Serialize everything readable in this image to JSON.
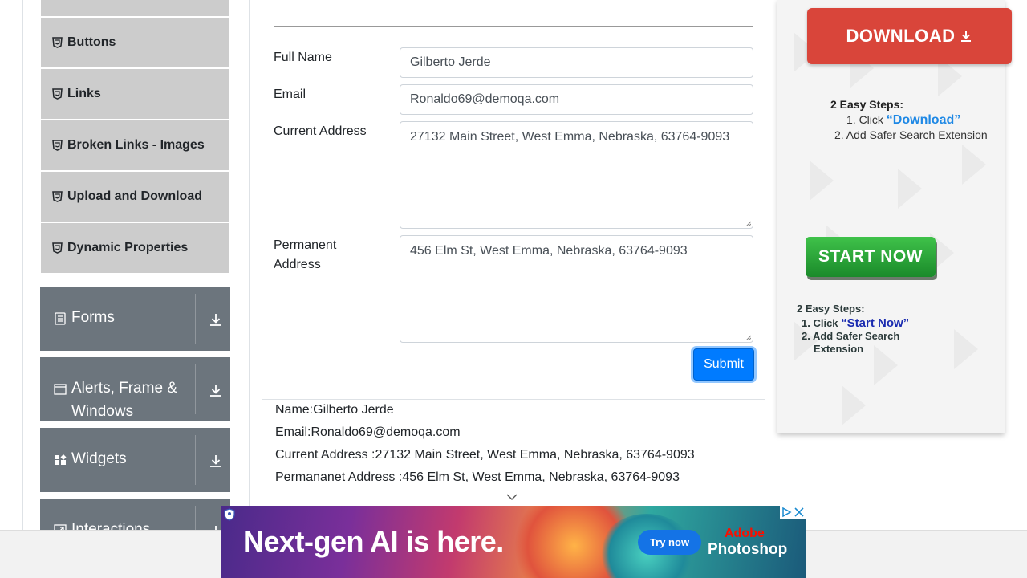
{
  "sidebar": {
    "elements_items": [
      {
        "label": "Buttons"
      },
      {
        "label": "Links"
      },
      {
        "label": "Broken Links - Images"
      },
      {
        "label": "Upload and Download"
      },
      {
        "label": "Dynamic Properties"
      }
    ],
    "groups": [
      {
        "label_line1": "Forms",
        "label_line2": ""
      },
      {
        "label_line1": "Alerts, Frame &",
        "label_line2": "Windows"
      },
      {
        "label_line1": "Widgets",
        "label_line2": ""
      },
      {
        "label_line1": "Interactions",
        "label_line2": ""
      }
    ]
  },
  "form": {
    "full_name_label": "Full Name",
    "full_name_value": "Gilberto Jerde",
    "email_label": "Email",
    "email_value": "Ronaldo69@demoqa.com",
    "current_address_label": "Current Address",
    "current_address_value": "27132 Main Street, West Emma, Nebraska, 63764-9093",
    "permanent_address_label_line1": "Permanent",
    "permanent_address_label_line2": "Address",
    "permanent_address_value": "456 Elm St, West Emma, Nebraska, 63764-9093",
    "submit_label": "Submit"
  },
  "output": {
    "name": "Name:Gilberto Jerde",
    "email": "Email:Ronaldo69@demoqa.com",
    "current_address": "Current Address :27132 Main Street, West Emma, Nebraska, 63764-9093",
    "permanent_address": "Permananet Address :456 Elm St, West Emma, Nebraska, 63764-9093"
  },
  "right_ad": {
    "download_label": "DOWNLOAD",
    "steps1_heading": "2 Easy Steps:",
    "steps1_item1_prefix": "1. Click ",
    "steps1_item1_keyword": "“Download”",
    "steps1_item2": "2. Add Safer Search Extension",
    "start_label": "START NOW",
    "steps2_heading": "2 Easy Steps:",
    "steps2_item1_prefix": "1. Click ",
    "steps2_item1_keyword": "“Start Now”",
    "steps2_item2_line1": "2. Add Safer Search",
    "steps2_item2_line2": "Extension"
  },
  "banner_ad": {
    "headline": "Next-gen AI is here.",
    "cta": "Try now",
    "brand_line1": "Adobe",
    "brand_line2": "Photoshop"
  },
  "colors": {
    "primary": "#007bff",
    "sidebar_group": "#6c757d",
    "sidebar_item": "#cccccc",
    "download_red": "#d9453a",
    "start_green": "#2ea83a"
  },
  "icons": {
    "sidebar_item": "html5-icon",
    "forms": "document-icon",
    "alerts": "window-icon",
    "widgets": "widgets-icon",
    "interactions": "interactions-icon",
    "group_toggle": "download-arrow-icon",
    "scroll_hint": "chevron-down-icon"
  }
}
